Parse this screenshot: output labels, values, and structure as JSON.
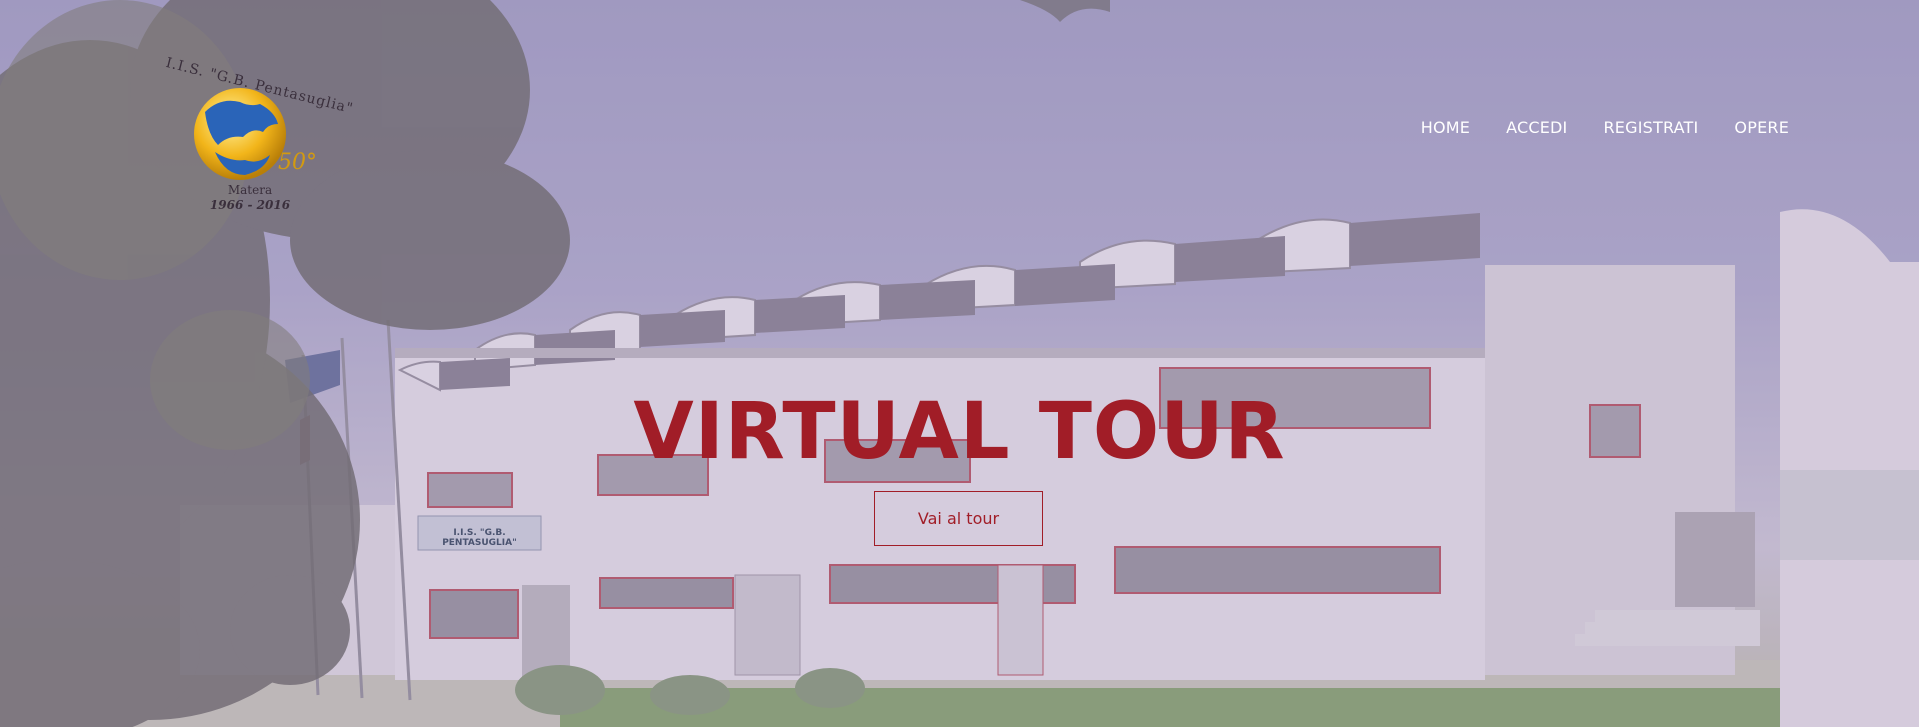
{
  "logo": {
    "arc_text": "I.I.S. \"G.B. Pentasuglia\"",
    "anniversary": "50°",
    "city": "Matera",
    "years": "1966 - 2016"
  },
  "nav": {
    "items": [
      "HOME",
      "ACCEDI",
      "REGISTRATI",
      "OPERE"
    ]
  },
  "hero": {
    "title": "VIRTUAL TOUR",
    "cta_label": "Vai al tour",
    "sign_text": "I.I.S. \"G.B. PENTASUGLIA\""
  },
  "colors": {
    "accent": "#a11d27",
    "nav_text": "#ffffff",
    "sky": "#9a96bd"
  }
}
